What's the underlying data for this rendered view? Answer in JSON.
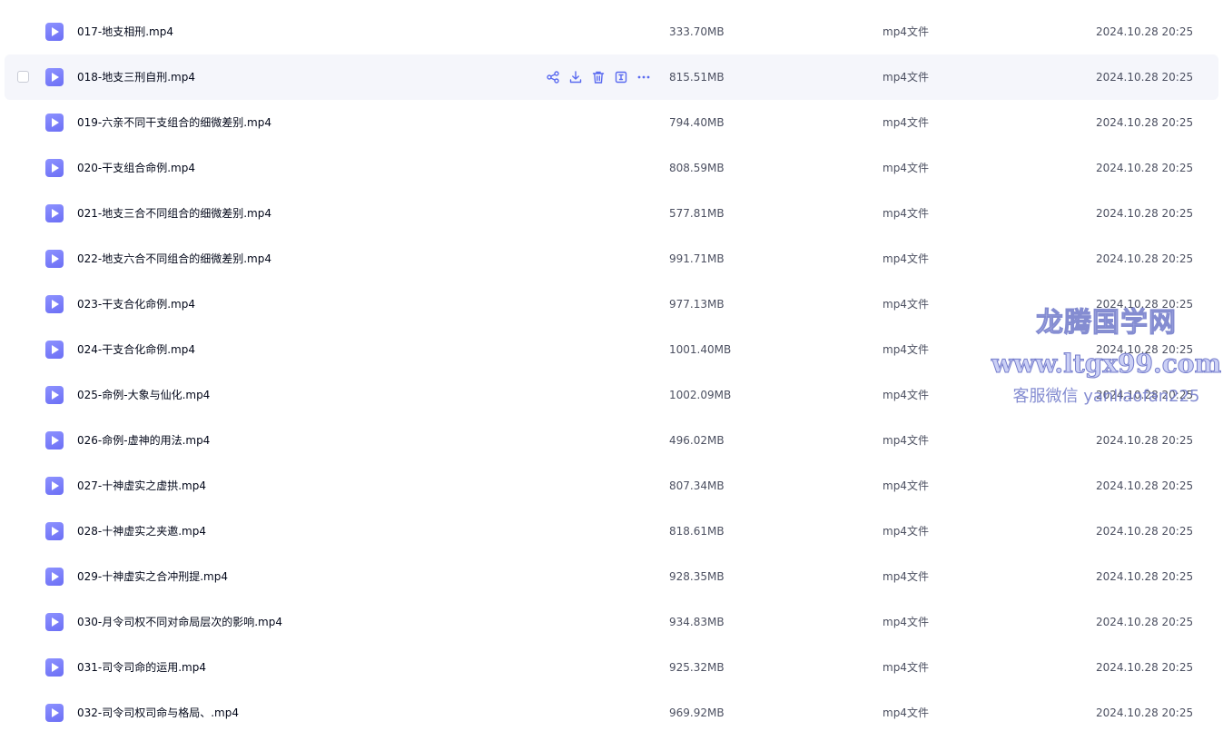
{
  "files": [
    {
      "name": "017-地支相刑.mp4",
      "size": "333.70MB",
      "type": "mp4文件",
      "date": "2024.10.28 20:25"
    },
    {
      "name": "018-地支三刑自刑.mp4",
      "size": "815.51MB",
      "type": "mp4文件",
      "date": "2024.10.28 20:25",
      "hovered": true
    },
    {
      "name": "019-六亲不同干支组合的细微差别.mp4",
      "size": "794.40MB",
      "type": "mp4文件",
      "date": "2024.10.28 20:25"
    },
    {
      "name": "020-干支组合命例.mp4",
      "size": "808.59MB",
      "type": "mp4文件",
      "date": "2024.10.28 20:25"
    },
    {
      "name": "021-地支三合不同组合的细微差别.mp4",
      "size": "577.81MB",
      "type": "mp4文件",
      "date": "2024.10.28 20:25"
    },
    {
      "name": "022-地支六合不同组合的细微差别.mp4",
      "size": "991.71MB",
      "type": "mp4文件",
      "date": "2024.10.28 20:25"
    },
    {
      "name": "023-干支合化命例.mp4",
      "size": "977.13MB",
      "type": "mp4文件",
      "date": "2024.10.28 20:25"
    },
    {
      "name": "024-干支合化命例.mp4",
      "size": "1001.40MB",
      "type": "mp4文件",
      "date": "2024.10.28 20:25"
    },
    {
      "name": "025-命例-大象与仙化.mp4",
      "size": "1002.09MB",
      "type": "mp4文件",
      "date": "2024.10.28 20:25"
    },
    {
      "name": "026-命例-虚神的用法.mp4",
      "size": "496.02MB",
      "type": "mp4文件",
      "date": "2024.10.28 20:25"
    },
    {
      "name": "027-十神虚实之虚拱.mp4",
      "size": "807.34MB",
      "type": "mp4文件",
      "date": "2024.10.28 20:25"
    },
    {
      "name": "028-十神虚实之夹邀.mp4",
      "size": "818.61MB",
      "type": "mp4文件",
      "date": "2024.10.28 20:25"
    },
    {
      "name": "029-十神虚实之合冲刑提.mp4",
      "size": "928.35MB",
      "type": "mp4文件",
      "date": "2024.10.28 20:25"
    },
    {
      "name": "030-月令司权不同对命局层次的影响.mp4",
      "size": "934.83MB",
      "type": "mp4文件",
      "date": "2024.10.28 20:25"
    },
    {
      "name": "031-司令司命的运用.mp4",
      "size": "925.32MB",
      "type": "mp4文件",
      "date": "2024.10.28 20:25"
    },
    {
      "name": "032-司令司权司命与格局、.mp4",
      "size": "969.92MB",
      "type": "mp4文件",
      "date": "2024.10.28 20:25"
    }
  ],
  "row_actions": [
    {
      "icon": "share-icon"
    },
    {
      "icon": "download-icon"
    },
    {
      "icon": "delete-icon"
    },
    {
      "icon": "rename-icon"
    },
    {
      "icon": "more-icon"
    }
  ],
  "colors": {
    "accent": "#5b6bf0",
    "file_icon": "#7b7ff8",
    "hover_row": "#f5f6fb",
    "watermark": "#6f78c9"
  },
  "watermark": {
    "line1": "龙腾国学网",
    "line2": "www.ltgx99.com",
    "line3": "客服微信 yanliaofan225"
  }
}
